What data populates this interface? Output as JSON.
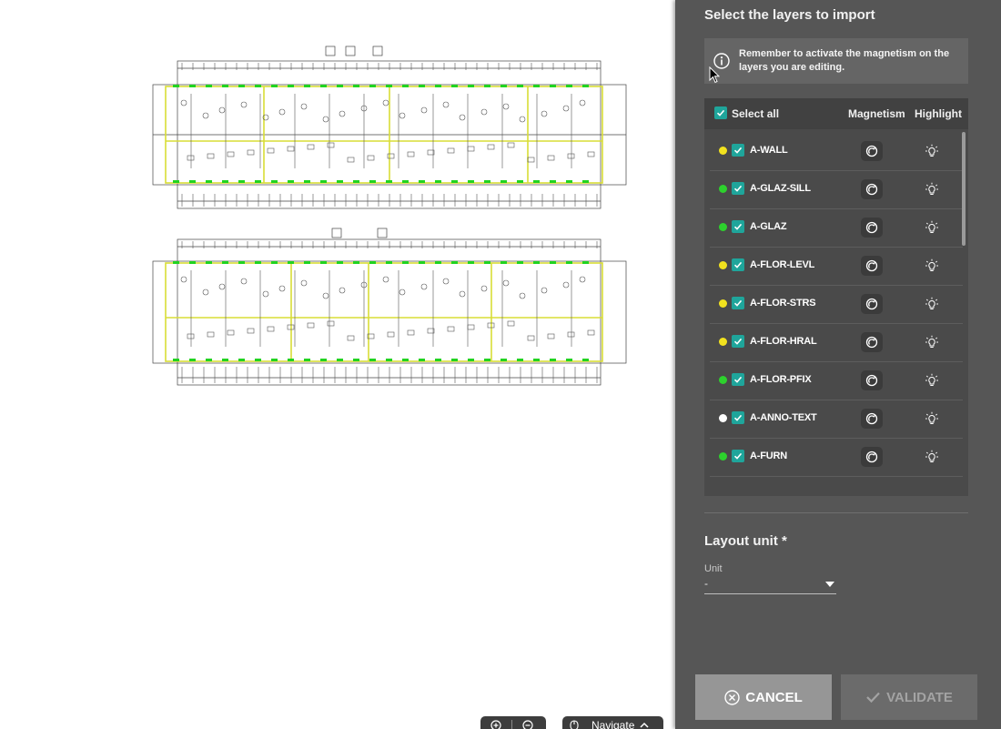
{
  "panel": {
    "title": "Select the layers to import",
    "info_icon": "info-icon",
    "info_text": "Remember to activate the magnetism on the layers you are editing.",
    "header": {
      "select_all": "Select all",
      "magnetism": "Magnetism",
      "highlight": "Highlight"
    },
    "layers": [
      {
        "name": "A-WALL",
        "color": "#f2e21e",
        "checked": true
      },
      {
        "name": "A-GLAZ-SILL",
        "color": "#2dd12d",
        "checked": true
      },
      {
        "name": "A-GLAZ",
        "color": "#2dd12d",
        "checked": true
      },
      {
        "name": "A-FLOR-LEVL",
        "color": "#f2e21e",
        "checked": true
      },
      {
        "name": "A-FLOR-STRS",
        "color": "#f2e21e",
        "checked": true
      },
      {
        "name": "A-FLOR-HRAL",
        "color": "#f2e21e",
        "checked": true
      },
      {
        "name": "A-FLOR-PFIX",
        "color": "#2dd12d",
        "checked": true
      },
      {
        "name": "A-ANNO-TEXT",
        "color": "#ffffff",
        "checked": true
      },
      {
        "name": "A-FURN",
        "color": "#2dd12d",
        "checked": true
      }
    ],
    "magnetism_icon": "magnet-icon",
    "highlight_icon": "lightbulb-icon",
    "unit_section_title": "Layout unit *",
    "unit_label": "Unit",
    "unit_value": "-",
    "cancel_label": "CANCEL",
    "validate_label": "VALIDATE",
    "checkbox_color": "#1fa59b"
  },
  "toolbar": {
    "zoom_in_icon": "zoom-in-icon",
    "zoom_out_icon": "zoom-out-icon",
    "navigate_label": "Navigate",
    "navigate_icon": "mouse-icon",
    "chevron_icon": "chevron-up-icon"
  }
}
